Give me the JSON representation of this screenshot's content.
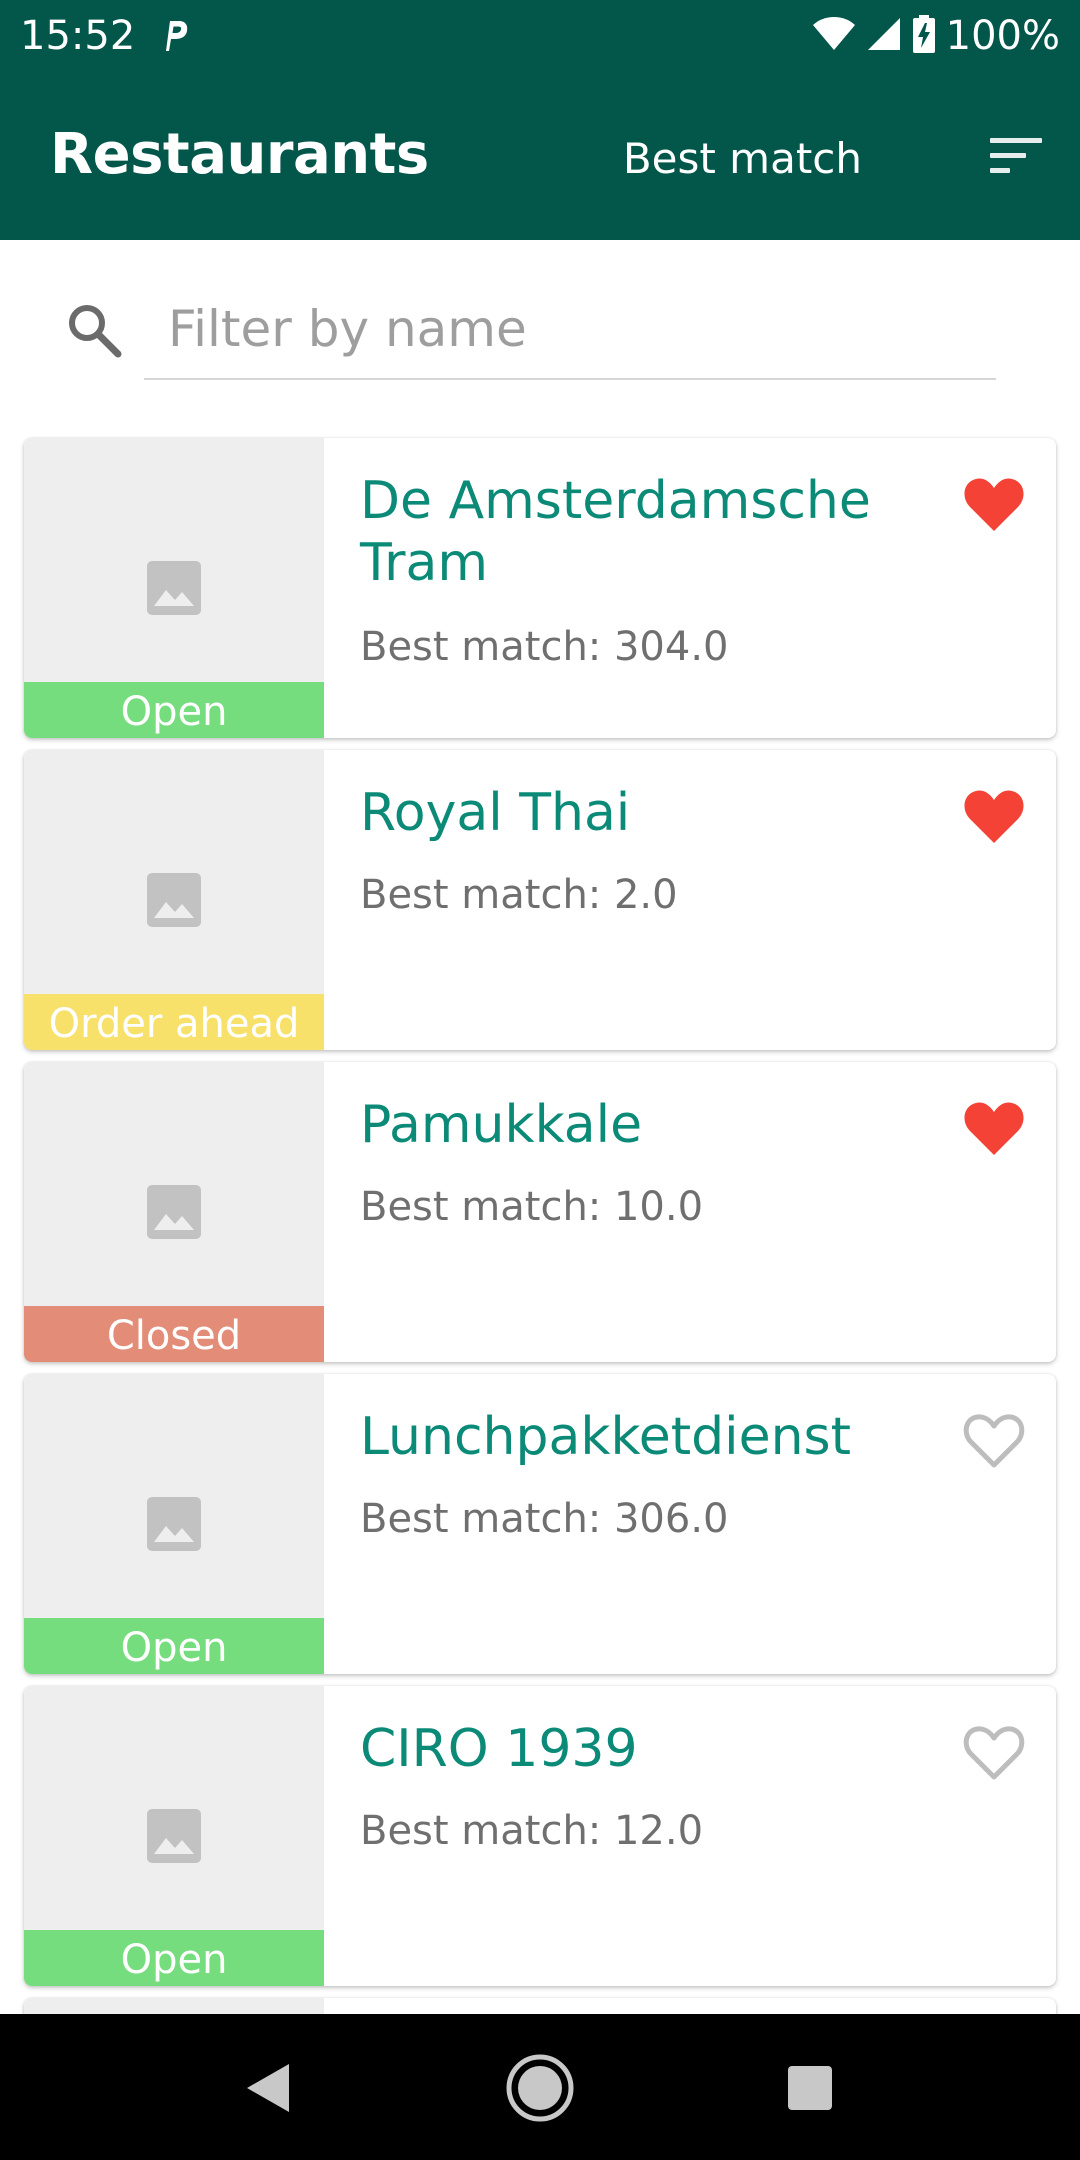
{
  "status_bar": {
    "time": "15:52",
    "battery": "100%"
  },
  "app_bar": {
    "title": "Restaurants",
    "sort_label": "Best match"
  },
  "search": {
    "placeholder": "Filter by name",
    "value": ""
  },
  "restaurants": [
    {
      "name": "De Amsterdamsche Tram",
      "subtitle": "Best match: 304.0",
      "status": "Open",
      "status_color": "#76dd7e",
      "favorite": true
    },
    {
      "name": "Royal Thai",
      "subtitle": "Best match: 2.0",
      "status": "Order ahead",
      "status_color": "#f8e16b",
      "favorite": true
    },
    {
      "name": "Pamukkale",
      "subtitle": "Best match: 10.0",
      "status": "Closed",
      "status_color": "#e38c78",
      "favorite": true
    },
    {
      "name": "Lunchpakketdienst",
      "subtitle": "Best match: 306.0",
      "status": "Open",
      "status_color": "#76dd7e",
      "favorite": false
    },
    {
      "name": "CIRO 1939",
      "subtitle": "Best match: 12.0",
      "status": "Open",
      "status_color": "#76dd7e",
      "favorite": false
    }
  ],
  "icons": {
    "placeholder_image": "image-placeholder-icon",
    "favorite_on": "heart-filled-icon",
    "favorite_off": "heart-outline-icon",
    "search": "search-icon",
    "sort": "sort-icon"
  },
  "colors": {
    "primary": "#02564a",
    "title_text": "#0c8a78",
    "heart": "#f44336",
    "heart_outline": "#bdbdbd"
  }
}
